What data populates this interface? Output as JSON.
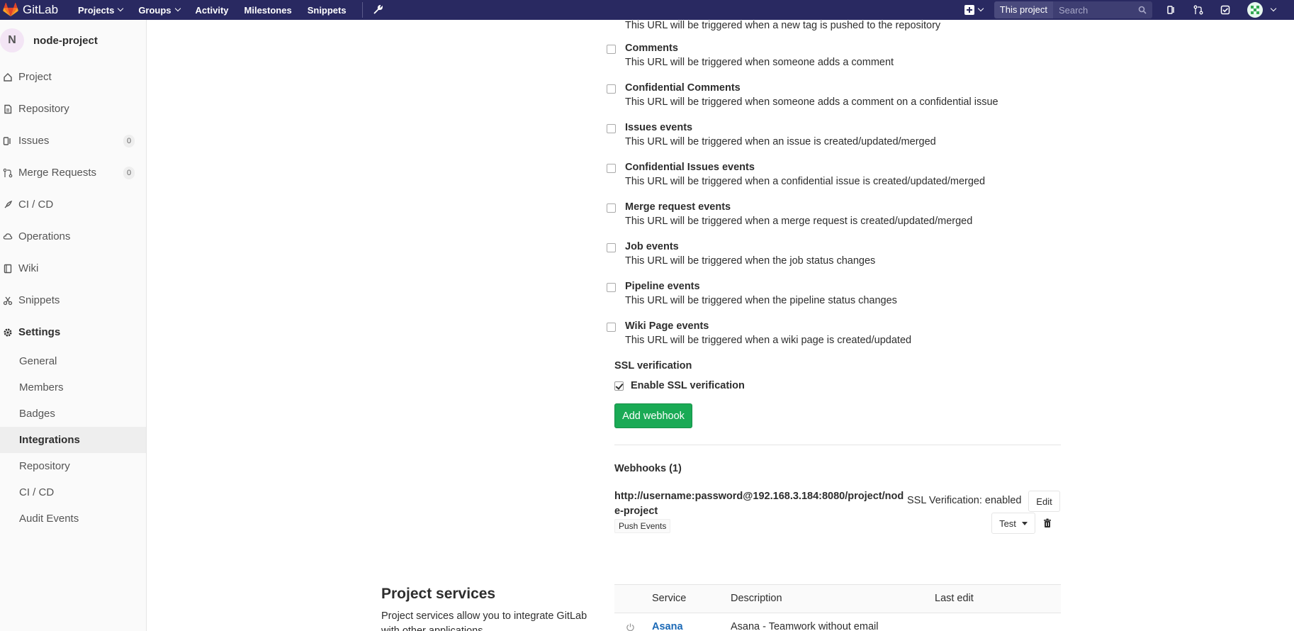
{
  "navbar": {
    "brand": "GitLab",
    "links": [
      "Projects",
      "Groups",
      "Activity",
      "Milestones",
      "Snippets"
    ],
    "scope": "This project",
    "search_placeholder": "Search"
  },
  "sidebar": {
    "avatar_letter": "N",
    "project_name": "node-project",
    "items": [
      {
        "label": "Project",
        "icon": "home-icon"
      },
      {
        "label": "Repository",
        "icon": "doc-icon"
      },
      {
        "label": "Issues",
        "icon": "issues-icon",
        "badge": "0"
      },
      {
        "label": "Merge Requests",
        "icon": "merge-icon",
        "badge": "0"
      },
      {
        "label": "CI / CD",
        "icon": "rocket-icon"
      },
      {
        "label": "Operations",
        "icon": "cloud-icon"
      },
      {
        "label": "Wiki",
        "icon": "book-icon"
      },
      {
        "label": "Snippets",
        "icon": "scissors-icon"
      },
      {
        "label": "Settings",
        "icon": "gear-icon"
      }
    ],
    "settings_sub": [
      "General",
      "Members",
      "Badges",
      "Integrations",
      "Repository",
      "CI / CD",
      "Audit Events"
    ]
  },
  "triggers": {
    "partial_desc": "This URL will be triggered when a new tag is pushed to the repository",
    "events": [
      {
        "title": "Comments",
        "desc": "This URL will be triggered when someone adds a comment"
      },
      {
        "title": "Confidential Comments",
        "desc": "This URL will be triggered when someone adds a comment on a confidential issue"
      },
      {
        "title": "Issues events",
        "desc": "This URL will be triggered when an issue is created/updated/merged"
      },
      {
        "title": "Confidential Issues events",
        "desc": "This URL will be triggered when a confidential issue is created/updated/merged"
      },
      {
        "title": "Merge request events",
        "desc": "This URL will be triggered when a merge request is created/updated/merged"
      },
      {
        "title": "Job events",
        "desc": "This URL will be triggered when the job status changes"
      },
      {
        "title": "Pipeline events",
        "desc": "This URL will be triggered when the pipeline status changes"
      },
      {
        "title": "Wiki Page events",
        "desc": "This URL will be triggered when a wiki page is created/updated"
      }
    ]
  },
  "ssl": {
    "label": "SSL verification",
    "checkbox_label": "Enable SSL verification",
    "checked": true
  },
  "add_webhook_label": "Add webhook",
  "webhooks": {
    "title": "Webhooks (1)",
    "url": "http://username:password@192.168.3.184:8080/project/node-project",
    "tag": "Push Events",
    "ssl_status": "SSL Verification: enabled",
    "edit_label": "Edit",
    "test_label": "Test"
  },
  "project_services": {
    "title": "Project services",
    "desc": "Project services allow you to integrate GitLab with other applications",
    "headers": [
      "Service",
      "Description",
      "Last edit"
    ],
    "rows": [
      {
        "service": "Asana",
        "description": "Asana - Teamwork without email",
        "last_edit": ""
      }
    ]
  },
  "colors": {
    "navbar": "#292961",
    "primary_button": "#1aaa55",
    "link": "#1b69b6"
  }
}
